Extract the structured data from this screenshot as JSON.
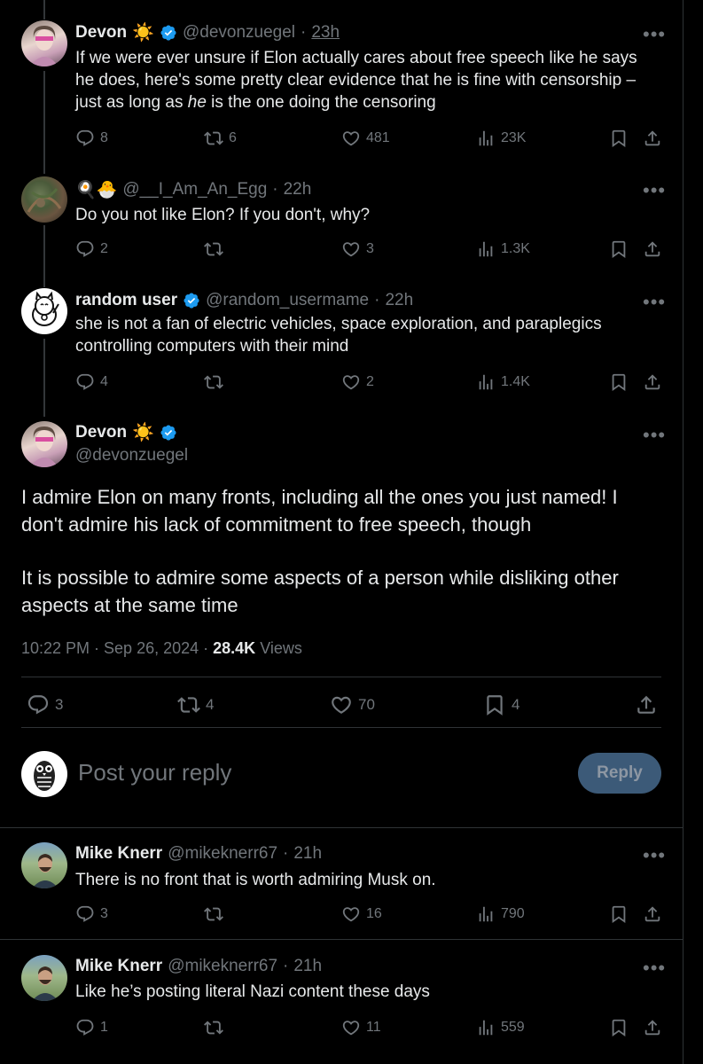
{
  "tweets": [
    {
      "name": "Devon",
      "handle": "@devonzuegel",
      "time": "23h",
      "text_pre": "If we were ever unsure if Elon actually cares about free speech like he says he does, here's some pretty clear evidence that he is fine with censorship – just as long as ",
      "text_em": "he",
      "text_post": " is the one doing the censoring",
      "replies": "8",
      "retweets": "6",
      "likes": "481",
      "views": "23K"
    },
    {
      "name": "🍳🐣",
      "handle": "@__I_Am_An_Egg",
      "time": "22h",
      "text": "Do you not like Elon? If you don't, why?",
      "replies": "2",
      "retweets": "",
      "likes": "3",
      "views": "1.3K"
    },
    {
      "name": "random user",
      "handle": "@random_usermame",
      "time": "22h",
      "text": "she is not a fan of electric vehicles, space exploration, and paraplegics controlling computers with their mind",
      "replies": "4",
      "retweets": "",
      "likes": "2",
      "views": "1.4K"
    }
  ],
  "main_tweet": {
    "name": "Devon",
    "handle": "@devonzuegel",
    "paragraph1": "I admire Elon on many fronts, including all the ones you just named! I don't admire his lack of commitment to free speech, though",
    "paragraph2": "It is possible to admire some aspects of a person while disliking other aspects at the same time",
    "timestamp": "10:22 PM · Sep 26, 2024 · ",
    "views_count": "28.4K",
    "views_label": " Views",
    "replies": "3",
    "retweets": "4",
    "likes": "70",
    "bookmarks": "4"
  },
  "reply_box": {
    "placeholder": "Post your reply",
    "button": "Reply"
  },
  "replies": [
    {
      "name": "Mike Knerr",
      "handle": "@mikeknerr67",
      "time": "21h",
      "text": "There is no front that is worth admiring Musk on.",
      "replies": "3",
      "retweets": "",
      "likes": "16",
      "views": "790"
    },
    {
      "name": "Mike Knerr",
      "handle": "@mikeknerr67",
      "time": "21h",
      "text": "Like he’s posting literal Nazi content these days",
      "replies": "1",
      "retweets": "",
      "likes": "11",
      "views": "559"
    }
  ],
  "icons": {
    "reply": "reply-icon",
    "retweet": "retweet-icon",
    "like": "heart-icon",
    "views": "views-icon",
    "bookmark": "bookmark-icon",
    "share": "share-icon",
    "more": "more-icon",
    "verified": "verified-badge-icon",
    "sun": "sun-emoji"
  },
  "colors": {
    "background": "#000000",
    "text": "#e7e9ea",
    "muted": "#71767b",
    "verified": "#1d9bf0",
    "reply_button": "#3c5a78"
  },
  "more_glyph": "•••",
  "sun_glyph": "☀️"
}
